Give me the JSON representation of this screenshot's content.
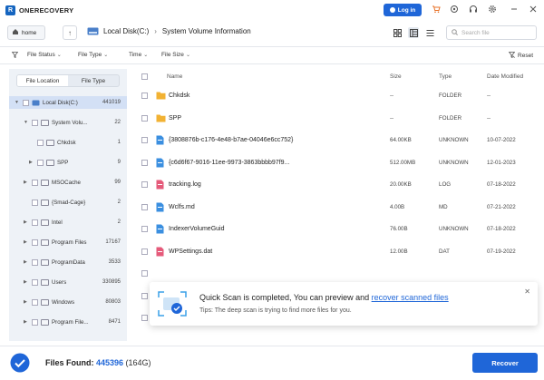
{
  "app": {
    "title": "ONERECOVERY",
    "logo_letter": "R",
    "login_label": "Log in"
  },
  "titlebar_icons": [
    "cart-icon",
    "refresh-icon",
    "headset-icon",
    "settings-icon",
    "minimize-icon",
    "close-icon"
  ],
  "toolbar": {
    "home_label": "home",
    "breadcrumb": [
      "Local Disk(C:)",
      "System Volume Information"
    ],
    "search_placeholder": "Search file"
  },
  "filters": {
    "file_status": "File Status",
    "file_type": "File Type",
    "time": "Time",
    "file_size": "File Size",
    "reset": "Reset"
  },
  "sidebar": {
    "tabs": [
      "File Location",
      "File Type"
    ],
    "tree": [
      {
        "label": "Local Disk(C:)",
        "count": "441019"
      },
      {
        "label": "System Volu...",
        "count": "22"
      },
      {
        "label": "Chkdsk",
        "count": "1"
      },
      {
        "label": "SPP",
        "count": "9"
      },
      {
        "label": "MSOCache",
        "count": "99"
      },
      {
        "label": "{Smad-Cage}",
        "count": "2"
      },
      {
        "label": "Intel",
        "count": "2"
      },
      {
        "label": "Program Files",
        "count": "17167"
      },
      {
        "label": "ProgramData",
        "count": "3533"
      },
      {
        "label": "Users",
        "count": "330895"
      },
      {
        "label": "Windows",
        "count": "80803"
      },
      {
        "label": "Program File...",
        "count": "8471"
      }
    ]
  },
  "filelist": {
    "columns": {
      "name": "Name",
      "size": "Size",
      "type": "Type",
      "date": "Date Modified"
    },
    "rows": [
      {
        "name": "Chkdsk",
        "size": "--",
        "type": "FOLDER",
        "date": "--",
        "icon": "folder"
      },
      {
        "name": "SPP",
        "size": "--",
        "type": "FOLDER",
        "date": "--",
        "icon": "folder"
      },
      {
        "name": "{3808876b-c176-4e48-b7ae-04046e6cc752}",
        "size": "64.00KB",
        "type": "UNKNOWN",
        "date": "10-07-2022",
        "icon": "file"
      },
      {
        "name": "{c6d6f67-9016-11ee-9973-3863bbbb97f9...",
        "size": "512.00MB",
        "type": "UNKNOWN",
        "date": "12-01-2023",
        "icon": "file"
      },
      {
        "name": "tracking.log",
        "size": "20.00KB",
        "type": "LOG",
        "date": "07-18-2022",
        "icon": "log"
      },
      {
        "name": "Wclfs.md",
        "size": "4.00B",
        "type": "MD",
        "date": "07-21-2022",
        "icon": "file"
      },
      {
        "name": "IndexerVolumeGuid",
        "size": "76.00B",
        "type": "UNKNOWN",
        "date": "07-18-2022",
        "icon": "file"
      },
      {
        "name": "WPSettings.dat",
        "size": "12.00B",
        "type": "DAT",
        "date": "07-19-2022",
        "icon": "log"
      }
    ]
  },
  "toast": {
    "title": "Quick Scan is completed, You can preview and ",
    "link": "recover scanned files",
    "tip": "Tips: The deep scan is trying to find more files for you."
  },
  "footer": {
    "found_label": "Files Found: ",
    "found_count": "445396",
    "found_size": " (164G)",
    "recover_label": "Recover"
  }
}
